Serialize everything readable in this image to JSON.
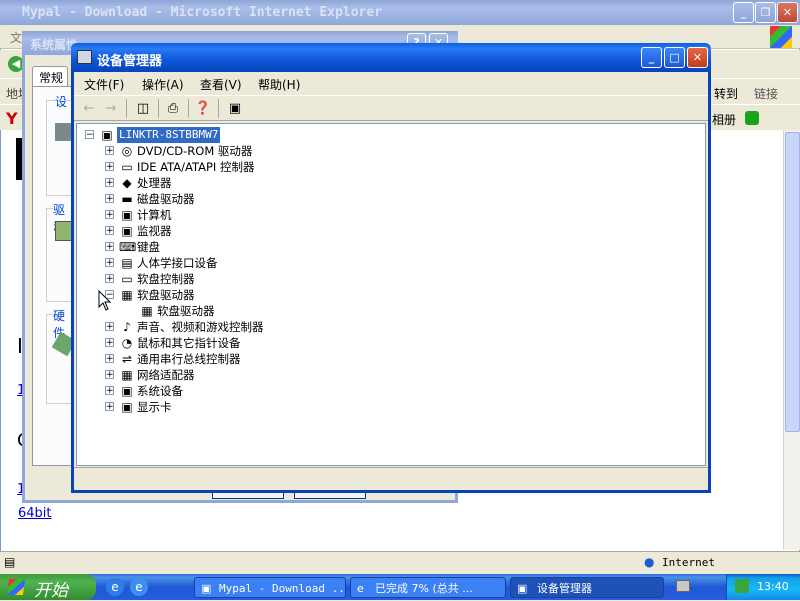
{
  "ie": {
    "title": "Mypal - Download - Microsoft Internet Explorer",
    "menu_first": "文",
    "addr_label": "地址",
    "goto_label": "转到",
    "links_label": "链接",
    "toolbar2_text": "相册",
    "page_link_text": "64bit",
    "status_zone": "Internet",
    "frag_i": "I",
    "frag_c": "C",
    "frag_1": "1",
    "frag_2": "1"
  },
  "sysprops": {
    "title": "系统属性",
    "tab_general": "常规",
    "group1_label": "设",
    "group2_label": "驱动",
    "group3_label": "硬件"
  },
  "devmgr": {
    "title": "设备管理器",
    "menu": [
      "文件(F)",
      "操作(A)",
      "查看(V)",
      "帮助(H)"
    ],
    "root": "LINKTR-8STBBMW7",
    "items": [
      {
        "label": "DVD/CD-ROM 驱动器",
        "icon": "cdrom-icon",
        "glyph": "◎"
      },
      {
        "label": "IDE ATA/ATAPI 控制器",
        "icon": "ide-controller-icon",
        "glyph": "▭"
      },
      {
        "label": "处理器",
        "icon": "processor-icon",
        "glyph": "◆"
      },
      {
        "label": "磁盘驱动器",
        "icon": "disk-drive-icon",
        "glyph": "▬"
      },
      {
        "label": "计算机",
        "icon": "computer-icon",
        "glyph": "▣"
      },
      {
        "label": "监视器",
        "icon": "monitor-icon",
        "glyph": "▣"
      },
      {
        "label": "键盘",
        "icon": "keyboard-icon",
        "glyph": "⌨"
      },
      {
        "label": "人体学接口设备",
        "icon": "hid-icon",
        "glyph": "▤"
      },
      {
        "label": "软盘控制器",
        "icon": "floppy-controller-icon",
        "glyph": "▭"
      },
      {
        "label": "软盘驱动器",
        "icon": "floppy-drive-icon",
        "glyph": "▦",
        "expanded": true,
        "child": "软盘驱动器"
      },
      {
        "label": "声音、视频和游戏控制器",
        "icon": "sound-icon",
        "glyph": "♪"
      },
      {
        "label": "鼠标和其它指针设备",
        "icon": "mouse-icon",
        "glyph": "◔"
      },
      {
        "label": "通用串行总线控制器",
        "icon": "usb-icon",
        "glyph": "⇌"
      },
      {
        "label": "网络适配器",
        "icon": "network-adapter-icon",
        "glyph": "▦"
      },
      {
        "label": "系统设备",
        "icon": "system-device-icon",
        "glyph": "▣"
      },
      {
        "label": "显示卡",
        "icon": "display-adapter-icon",
        "glyph": "▣"
      }
    ]
  },
  "taskbar": {
    "start": "开始",
    "tasks": [
      "Mypal - Download ...",
      "已完成 7% (总共 ...",
      "设备管理器"
    ],
    "clock": "13:40"
  }
}
